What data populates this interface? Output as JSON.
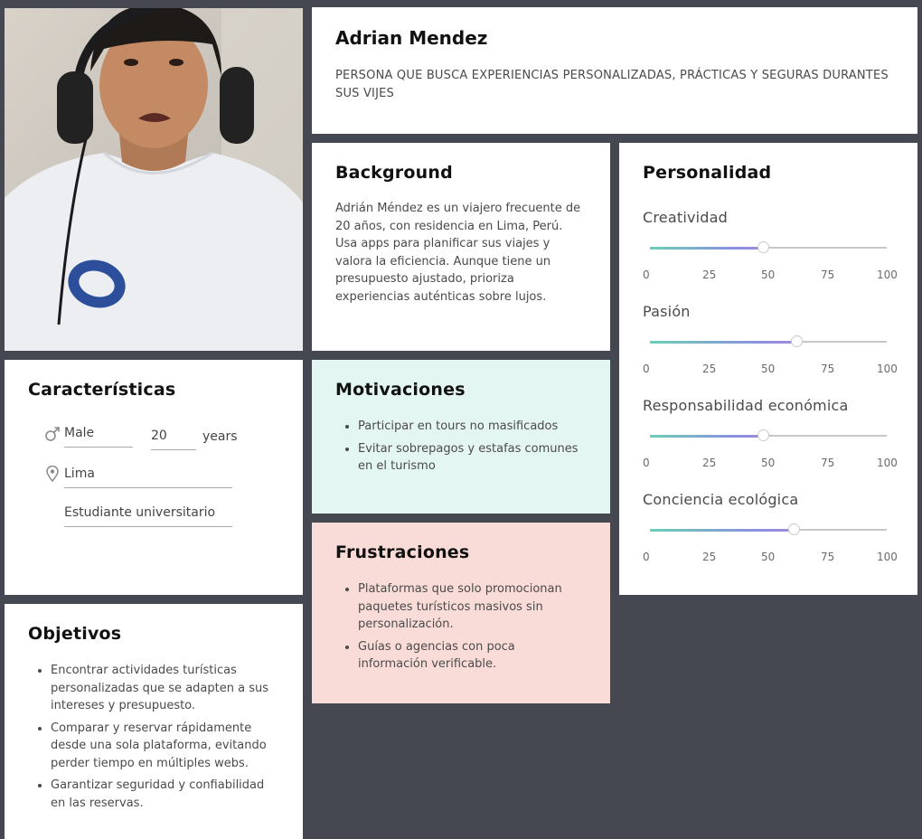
{
  "persona": {
    "name": "Adrian Mendez",
    "tagline": "PERSONA QUE BUSCA EXPERIENCIAS PERSONALIZADAS, PRÁCTICAS Y SEGURAS DURANTES SUS VIJES"
  },
  "background": {
    "title": "Background",
    "text": "Adrián Méndez es un viajero frecuente de 20 años, con residencia en Lima, Perú. Usa apps para planificar sus viajes y valora la eficiencia. Aunque tiene un presupuesto ajustado, prioriza experiencias auténticas sobre lujos."
  },
  "characteristics": {
    "title": "Características",
    "gender": "Male",
    "age": "20",
    "age_unit": "years",
    "location": "Lima",
    "occupation": "Estudiante universitario"
  },
  "motivations": {
    "title": "Motivaciones",
    "items": [
      "Participar en tours no masificados",
      "Evitar sobrepagos y estafas comunes en el turismo"
    ]
  },
  "frustrations": {
    "title": "Frustraciones",
    "items": [
      "Plataformas que solo promocionan paquetes turísticos masivos sin personalización.",
      "Guías o agencias con poca información verificable."
    ]
  },
  "objectives": {
    "title": "Objetivos",
    "items": [
      "Encontrar actividades turísticas personalizadas que se adapten a sus intereses y presupuesto.",
      "Comparar y reservar rápidamente desde una sola plataforma, evitando perder tiempo en múltiples webs.",
      "Garantizar seguridad y confiabilidad en las reservas."
    ]
  },
  "personality": {
    "title": "Personalidad",
    "tick_labels": [
      "0",
      "25",
      "50",
      "75",
      "100"
    ],
    "sliders": [
      {
        "label": "Creatividad",
        "value": 48
      },
      {
        "label": "Pasión",
        "value": 62
      },
      {
        "label": "Responsabilidad económica",
        "value": 48
      },
      {
        "label": "Conciencia ecológica",
        "value": 61
      }
    ]
  },
  "colors": {
    "page_background": "#454850",
    "motivations_background": "#e4f6f1",
    "frustrations_background": "#f9dcd7",
    "slider_gradient_start": "#6ccfb6",
    "slider_gradient_end": "#9f8be0"
  },
  "icons": {
    "gender": "male-symbol-icon",
    "location": "map-pin-icon"
  }
}
